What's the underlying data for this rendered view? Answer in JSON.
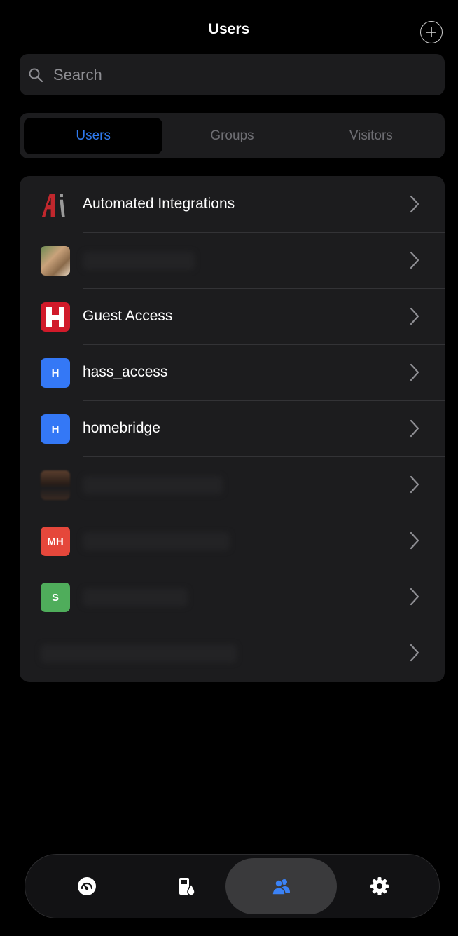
{
  "header": {
    "title": "Users",
    "add_icon": "plus-circle-icon"
  },
  "search": {
    "placeholder": "Search",
    "icon": "search-icon"
  },
  "segments": [
    {
      "label": "Users",
      "active": true
    },
    {
      "label": "Groups",
      "active": false
    },
    {
      "label": "Visitors",
      "active": false
    }
  ],
  "users": [
    {
      "label": "Automated Integrations",
      "icon_type": "ai-logo"
    },
    {
      "label": "",
      "icon_type": "photo",
      "redacted": true
    },
    {
      "label": "Guest Access",
      "icon_type": "h-logo"
    },
    {
      "label": "hass_access",
      "icon_type": "initials",
      "initials": "H",
      "color": "#3478f6"
    },
    {
      "label": "homebridge",
      "icon_type": "initials",
      "initials": "H",
      "color": "#3478f6"
    },
    {
      "label": "",
      "icon_type": "photo",
      "redacted": true
    },
    {
      "label": "",
      "icon_type": "initials",
      "initials": "MH",
      "color": "#e5473b",
      "redacted": true
    },
    {
      "label": "",
      "icon_type": "initials",
      "initials": "S",
      "color": "#4fad5b",
      "redacted": true
    },
    {
      "label": "",
      "icon_type": "none",
      "redacted": true
    }
  ],
  "tabbar": [
    {
      "name": "dashboard",
      "icon": "gauge-icon",
      "active": false
    },
    {
      "name": "devices",
      "icon": "devices-icon",
      "active": false
    },
    {
      "name": "users",
      "icon": "users-icon",
      "active": true
    },
    {
      "name": "settings",
      "icon": "gear-icon",
      "active": false
    }
  ],
  "colors": {
    "accent": "#2f7bf0",
    "background": "#000000",
    "card": "#1c1c1e",
    "ai_red": "#c0272d",
    "guest_red": "#d11a2a"
  }
}
